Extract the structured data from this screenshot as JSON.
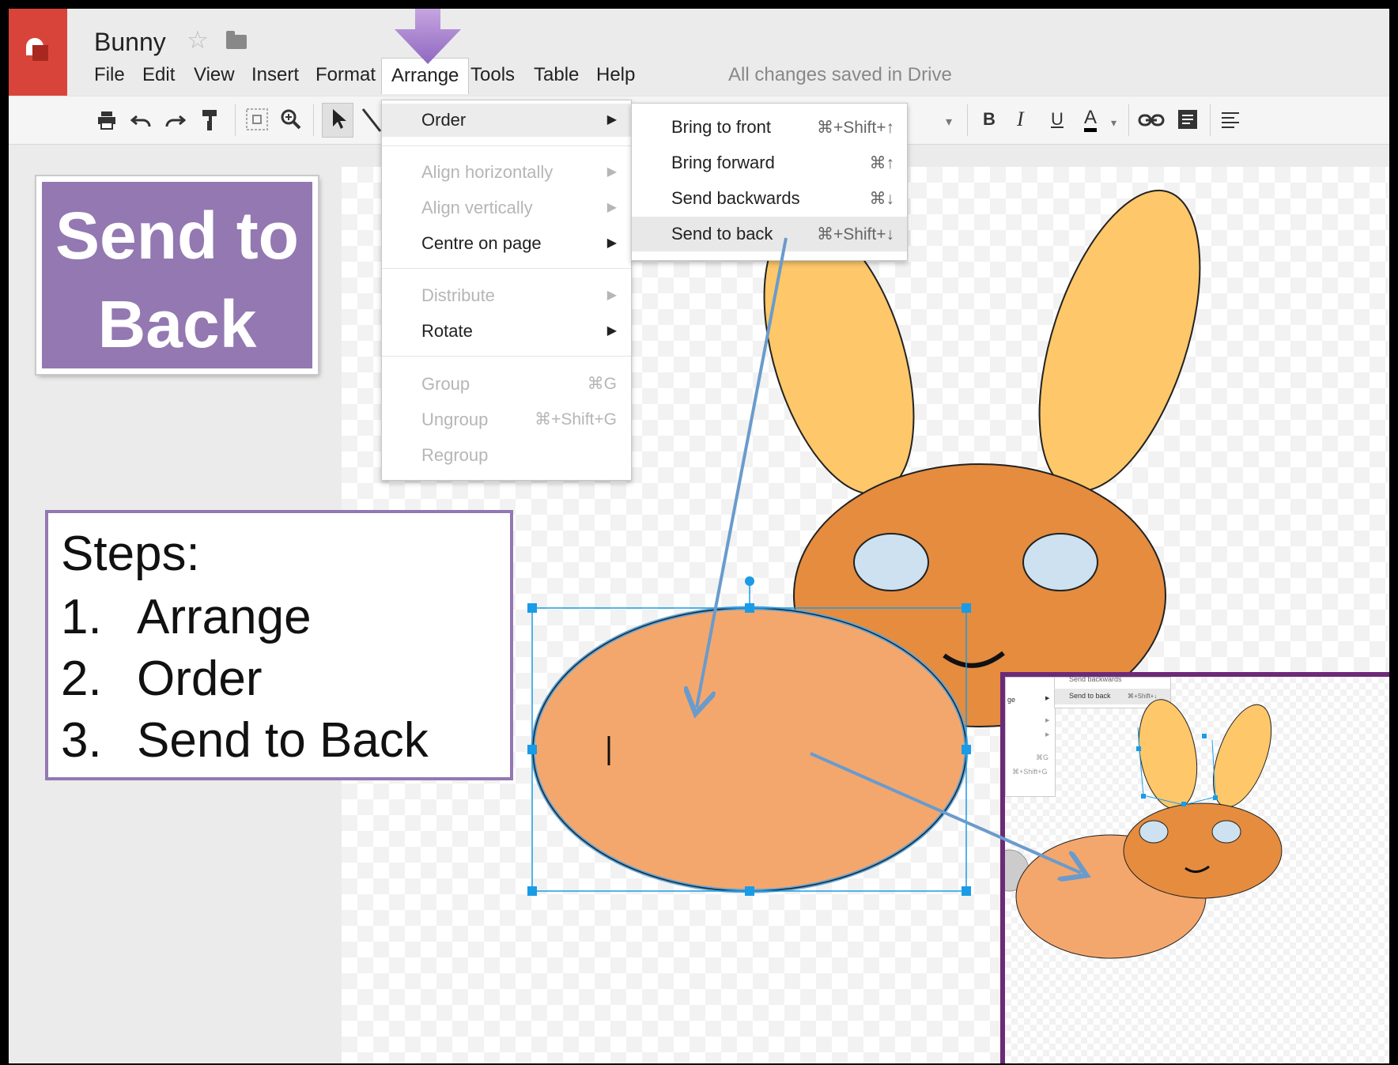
{
  "app": {
    "doc_title": "Bunny",
    "saved_status": "All changes saved in Drive"
  },
  "menubar": [
    {
      "label": "File"
    },
    {
      "label": "Edit"
    },
    {
      "label": "View"
    },
    {
      "label": "Insert"
    },
    {
      "label": "Format"
    },
    {
      "label": "Arrange"
    },
    {
      "label": "Tools"
    },
    {
      "label": "Table"
    },
    {
      "label": "Help"
    }
  ],
  "toolbar": {
    "print_icon": "print-icon",
    "undo_icon": "undo-icon",
    "redo_icon": "redo-icon",
    "paint_format_icon": "paint-format-icon",
    "fit_icon": "fit-icon",
    "zoom_icon": "zoom-icon",
    "select_icon": "select-icon",
    "line_icon": "line-icon",
    "bold": "B",
    "italic": "I",
    "underline": "U",
    "text_color": "A",
    "link_icon": "link-icon",
    "comment_icon": "comment-icon",
    "align_icon": "align-icon"
  },
  "arrange_menu": {
    "order": "Order",
    "align_horizontally": "Align horizontally",
    "align_vertically": "Align vertically",
    "centre_on_page": "Centre on page",
    "distribute": "Distribute",
    "rotate": "Rotate",
    "group": "Group",
    "group_shortcut": "⌘G",
    "ungroup": "Ungroup",
    "ungroup_shortcut": "⌘+Shift+G",
    "regroup": "Regroup"
  },
  "order_submenu": [
    {
      "label": "Bring to front",
      "shortcut": "⌘+Shift+↑"
    },
    {
      "label": "Bring forward",
      "shortcut": "⌘↑"
    },
    {
      "label": "Send backwards",
      "shortcut": "⌘↓"
    },
    {
      "label": "Send to back",
      "shortcut": "⌘+Shift+↓"
    }
  ],
  "callout": {
    "line1": "Send to",
    "line2": "Back"
  },
  "steps": {
    "heading": "Steps:",
    "items": [
      {
        "num": "1.",
        "text": "Arrange"
      },
      {
        "num": "2.",
        "text": "Order"
      },
      {
        "num": "3.",
        "text": "Send to Back"
      }
    ]
  },
  "inset": {
    "send_backwards": "Send backwards",
    "send_to_back": "Send to back",
    "shortcut": "⌘+Shift+↓",
    "group_shortcut": "⌘G",
    "ungroup_shortcut": "⌘+Shift+G",
    "partial_label": "ge"
  },
  "colors": {
    "accent_purple": "#9378b1",
    "inset_border": "#6c2a78",
    "ear": "#fdc76a",
    "head": "#e58c3f",
    "body": "#f4a76d",
    "eye": "#cde1f0",
    "selection": "#1a9be6",
    "arrow": "#6a9bcc"
  }
}
